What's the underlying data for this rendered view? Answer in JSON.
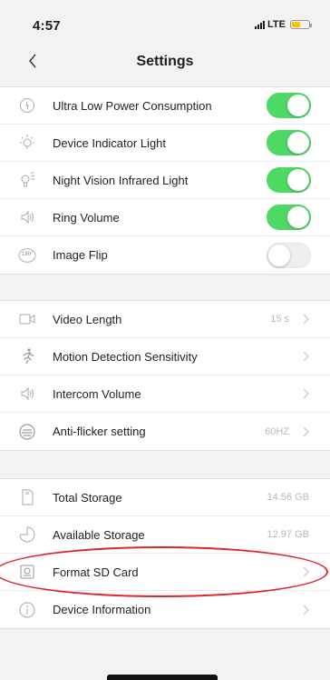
{
  "status": {
    "time": "4:57",
    "network": "LTE"
  },
  "nav": {
    "title": "Settings"
  },
  "section1": [
    {
      "label": "Ultra Low Power Consumption",
      "icon": "battery-saver-icon",
      "toggle": true
    },
    {
      "label": "Device Indicator Light",
      "icon": "lightbulb-icon",
      "toggle": true
    },
    {
      "label": "Night Vision Infrared Light",
      "icon": "infrared-bulb-icon",
      "toggle": true
    },
    {
      "label": "Ring Volume",
      "icon": "speaker-icon",
      "toggle": true
    },
    {
      "label": "Image Flip",
      "icon": "flip-180-icon",
      "toggle": false,
      "icon_text": "180°"
    }
  ],
  "section2": [
    {
      "label": "Video Length",
      "icon": "video-icon",
      "value": "15 s"
    },
    {
      "label": "Motion Detection Sensitivity",
      "icon": "running-person-icon",
      "value": ""
    },
    {
      "label": "Intercom Volume",
      "icon": "speaker-icon",
      "value": ""
    },
    {
      "label": "Anti-flicker setting",
      "icon": "flicker-icon",
      "value": "60HZ"
    }
  ],
  "section3": [
    {
      "label": "Total Storage",
      "icon": "sd-card-icon",
      "value": "14.56 GB"
    },
    {
      "label": "Available Storage",
      "icon": "pie-chart-icon",
      "value": "12.97 GB"
    },
    {
      "label": "Format SD Card",
      "icon": "format-sd-icon",
      "value": ""
    },
    {
      "label": "Device Information",
      "icon": "info-icon",
      "value": ""
    }
  ],
  "colors": {
    "toggle_on": "#4cd964",
    "highlight": "#e0242b",
    "battery": "#f5c700"
  }
}
